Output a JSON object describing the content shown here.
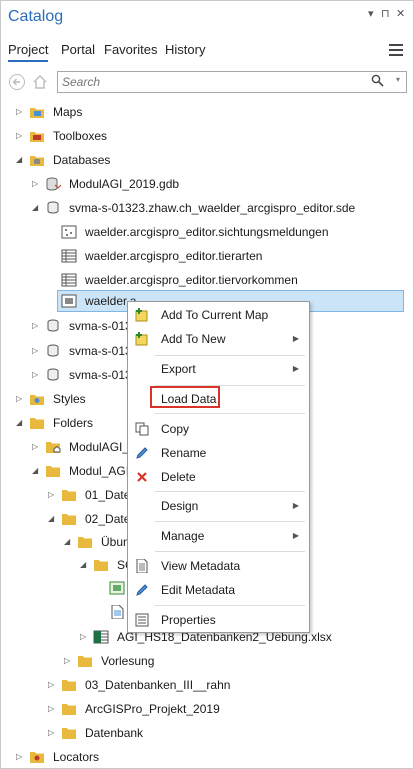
{
  "pane": {
    "title": "Catalog",
    "controls": [
      "▾",
      "⊓",
      "✕"
    ]
  },
  "tabs": [
    "Project",
    "Portal",
    "Favorites",
    "History"
  ],
  "search": {
    "placeholder": "Search"
  },
  "tree": {
    "maps": "Maps",
    "toolboxes": "Toolboxes",
    "databases": "Databases",
    "gdb": "ModulAGI_2019.gdb",
    "sde": "svma-s-01323.zhaw.ch_waelder_arcgispro_editor.sde",
    "fc1": "waelder.arcgispro_editor.sichtungsmeldungen",
    "fc2": "waelder.arcgispro_editor.tierarten",
    "fc3": "waelder.arcgispro_editor.tiervorkommen",
    "fc4": "waelder.a",
    "svma1": "svma-s-013",
    "svma2": "svma-s-013",
    "svma3": "svma-s-013",
    "styles": "Styles",
    "folders": "Folders",
    "modul1": "ModulAGI_",
    "modul2": "Modul_AGI",
    "f01": "01_Daten",
    "f02": "02_Daten",
    "uebung": "Übun",
    "sc": "SC",
    "xlsx": "AGI_HS18_Datenbanken2_Uebung.xlsx",
    "vorlesung": "Vorlesung",
    "f03": "03_Datenbanken_III__rahn",
    "arcgis": "ArcGISPro_Projekt_2019",
    "datenbank": "Datenbank",
    "locators": "Locators"
  },
  "menu": {
    "add_to_map": "Add To Current Map",
    "add_to_new": "Add To New",
    "export": "Export",
    "load_data": "Load Data",
    "copy": "Copy",
    "rename": "Rename",
    "delete": "Delete",
    "design": "Design",
    "manage": "Manage",
    "view_metadata": "View Metadata",
    "edit_metadata": "Edit Metadata",
    "properties": "Properties"
  },
  "colors": {
    "accent": "#2a6ebb",
    "selection": "#cce4f7",
    "highlight": "#d9342b",
    "folder": "#e8b93c"
  }
}
